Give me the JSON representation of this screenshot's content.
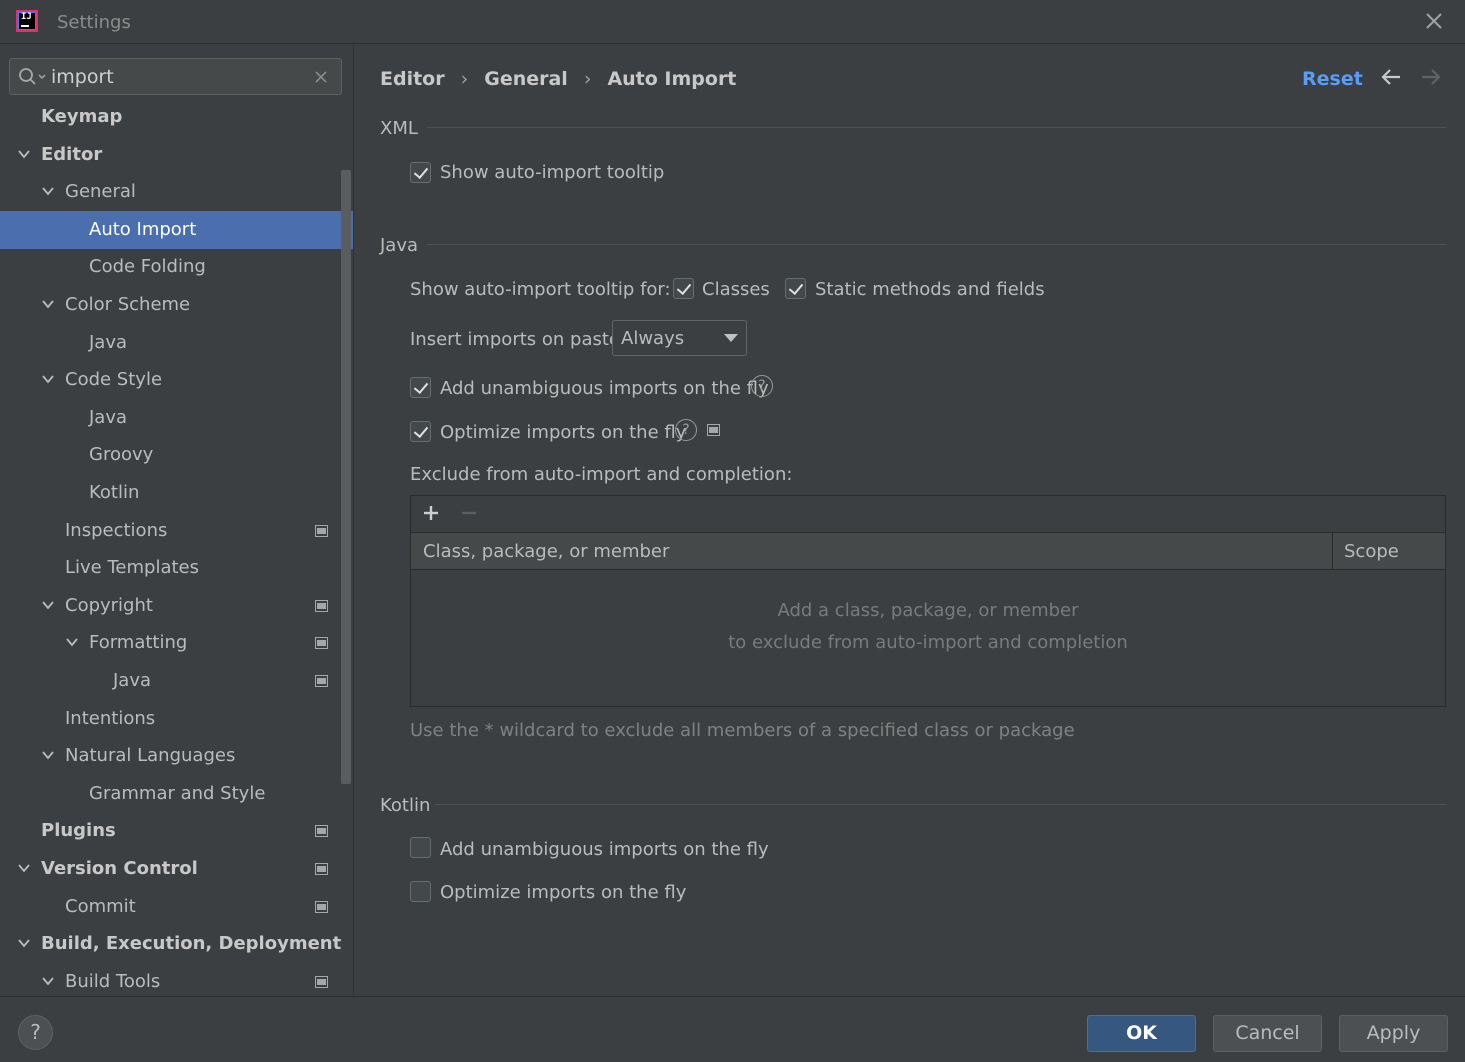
{
  "window": {
    "title": "Settings"
  },
  "search": {
    "value": "import"
  },
  "sidebar": {
    "items": [
      {
        "label": "Keymap",
        "level": 0,
        "expanded": null,
        "bold": true,
        "modified": false
      },
      {
        "label": "Editor",
        "level": 0,
        "expanded": true,
        "bold": true,
        "modified": false
      },
      {
        "label": "General",
        "level": 1,
        "expanded": true,
        "bold": false,
        "modified": false
      },
      {
        "label": "Auto Import",
        "level": 2,
        "expanded": null,
        "bold": false,
        "modified": false,
        "selected": true
      },
      {
        "label": "Code Folding",
        "level": 2,
        "expanded": null,
        "bold": false,
        "modified": false
      },
      {
        "label": "Color Scheme",
        "level": 1,
        "expanded": true,
        "bold": false,
        "modified": false
      },
      {
        "label": "Java",
        "level": 2,
        "expanded": null,
        "bold": false,
        "modified": false
      },
      {
        "label": "Code Style",
        "level": 1,
        "expanded": true,
        "bold": false,
        "modified": false
      },
      {
        "label": "Java",
        "level": 2,
        "expanded": null,
        "bold": false,
        "modified": false
      },
      {
        "label": "Groovy",
        "level": 2,
        "expanded": null,
        "bold": false,
        "modified": false
      },
      {
        "label": "Kotlin",
        "level": 2,
        "expanded": null,
        "bold": false,
        "modified": false
      },
      {
        "label": "Inspections",
        "level": 1,
        "expanded": null,
        "bold": false,
        "modified": true
      },
      {
        "label": "Live Templates",
        "level": 1,
        "expanded": null,
        "bold": false,
        "modified": false
      },
      {
        "label": "Copyright",
        "level": 1,
        "expanded": true,
        "bold": false,
        "modified": true
      },
      {
        "label": "Formatting",
        "level": 2,
        "expanded": true,
        "bold": false,
        "modified": true
      },
      {
        "label": "Java",
        "level": 3,
        "expanded": null,
        "bold": false,
        "modified": true
      },
      {
        "label": "Intentions",
        "level": 1,
        "expanded": null,
        "bold": false,
        "modified": false
      },
      {
        "label": "Natural Languages",
        "level": 1,
        "expanded": true,
        "bold": false,
        "modified": false
      },
      {
        "label": "Grammar and Style",
        "level": 2,
        "expanded": null,
        "bold": false,
        "modified": false
      },
      {
        "label": "Plugins",
        "level": 0,
        "expanded": null,
        "bold": true,
        "modified": true
      },
      {
        "label": "Version Control",
        "level": 0,
        "expanded": true,
        "bold": true,
        "modified": true
      },
      {
        "label": "Commit",
        "level": 1,
        "expanded": null,
        "bold": false,
        "modified": true
      },
      {
        "label": "Build, Execution, Deployment",
        "level": 0,
        "expanded": true,
        "bold": true,
        "modified": false
      },
      {
        "label": "Build Tools",
        "level": 1,
        "expanded": true,
        "bold": false,
        "modified": true
      }
    ]
  },
  "breadcrumb": {
    "items": [
      "Editor",
      "General",
      "Auto Import"
    ],
    "separator": "›"
  },
  "header": {
    "reset_label": "Reset"
  },
  "xml": {
    "title": "XML",
    "show_tooltip": {
      "label": "Show auto-import tooltip",
      "checked": true
    }
  },
  "java": {
    "title": "Java",
    "tooltip_for_label": "Show auto-import tooltip for:",
    "classes": {
      "label": "Classes",
      "checked": true
    },
    "static_members": {
      "label": "Static methods and fields",
      "checked": true
    },
    "insert_on_paste_label": "Insert imports on paste:",
    "insert_on_paste_value": "Always",
    "add_unambiguous": {
      "label": "Add unambiguous imports on the fly",
      "checked": true
    },
    "optimize": {
      "label": "Optimize imports on the fly",
      "checked": true
    },
    "exclude_label": "Exclude from auto-import and completion:",
    "table": {
      "columns": [
        "Class, package, or member",
        "Scope"
      ],
      "empty_line1": "Add a class, package, or member",
      "empty_line2": "to exclude from auto-import and completion"
    },
    "hint": "Use the * wildcard to exclude all members of a specified class or package"
  },
  "kotlin": {
    "title": "Kotlin",
    "add_unambiguous": {
      "label": "Add unambiguous imports on the fly",
      "checked": false
    },
    "optimize": {
      "label": "Optimize imports on the fly",
      "checked": false
    }
  },
  "footer": {
    "help": "?",
    "ok": "OK",
    "cancel": "Cancel",
    "apply": "Apply"
  },
  "colors": {
    "accent": "#589df6",
    "selection": "#4b6eaf",
    "background": "#3c3f41",
    "ok_button": "#365880"
  }
}
